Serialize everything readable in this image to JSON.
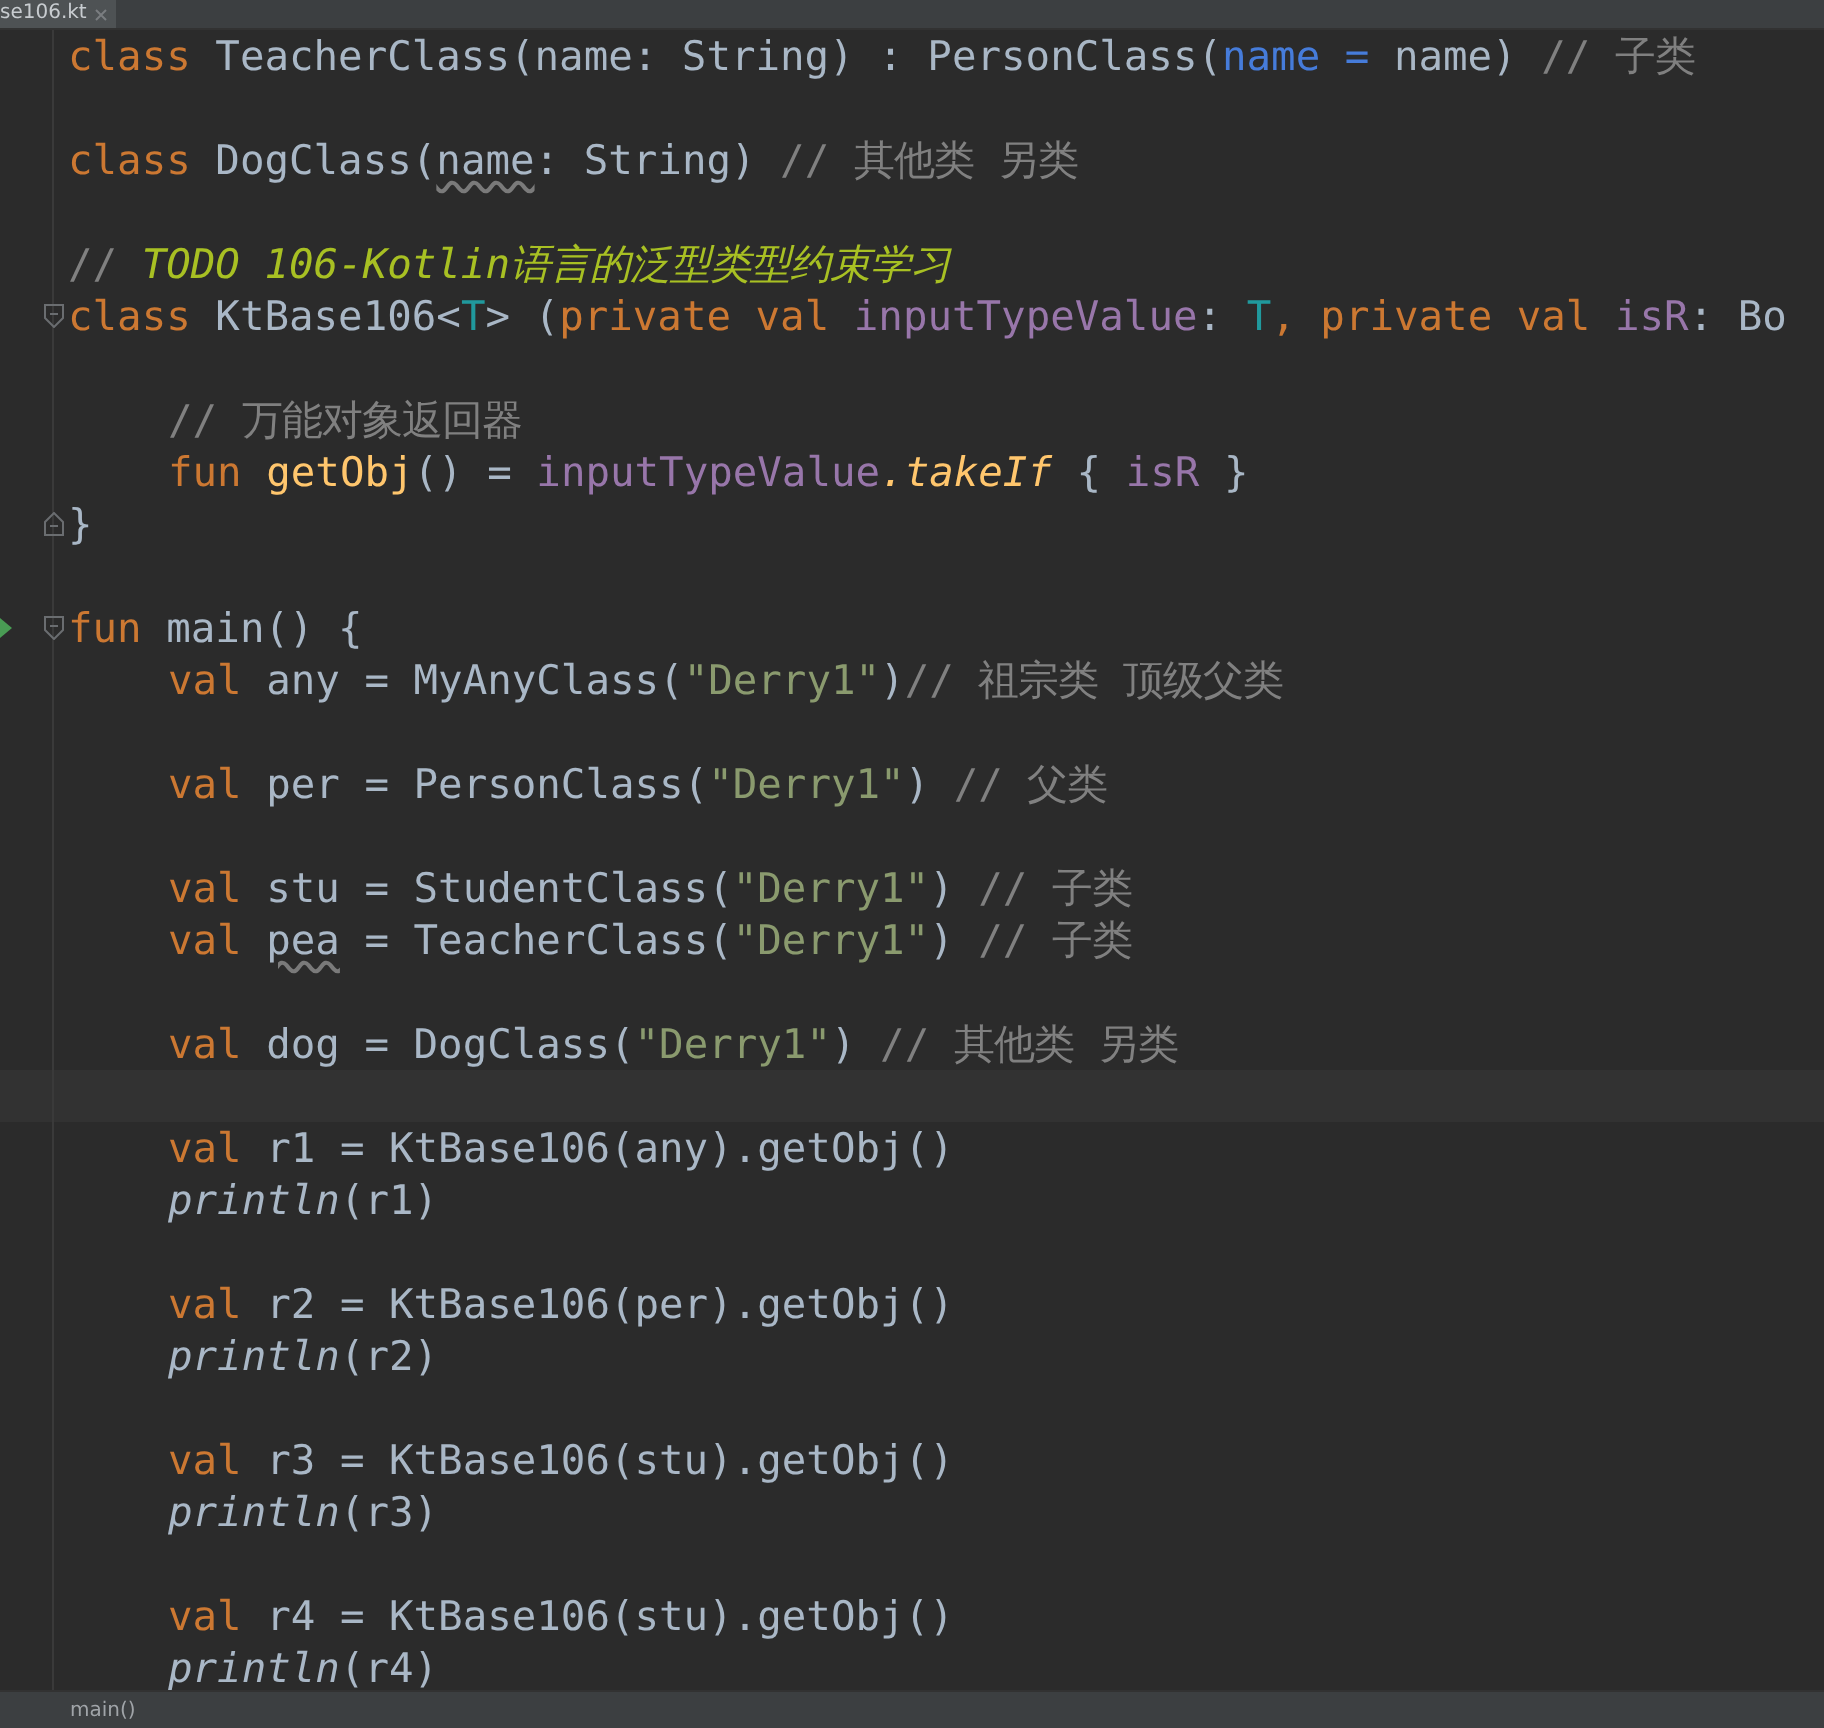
{
  "editor_tab": {
    "label": "se106.kt",
    "selected": true
  },
  "lines": [
    {
      "kind": "code",
      "indented": false,
      "fold_start": false,
      "fold_end": false,
      "runnable": false,
      "tokens": [
        {
          "text": "class ",
          "kind": "kw"
        },
        {
          "text": "TeacherClass(name: String) : PersonClass(",
          "kind": "plain"
        },
        {
          "text": "name = ",
          "kind": "param"
        },
        {
          "text": "name) ",
          "kind": "plain"
        },
        {
          "text": "// 子类",
          "kind": "comment"
        }
      ]
    },
    {
      "kind": "blank"
    },
    {
      "kind": "code",
      "indented": false,
      "fold_start": false,
      "fold_end": false,
      "runnable": false,
      "tokens": [
        {
          "text": "class ",
          "kind": "kw"
        },
        {
          "text": "DogClass(",
          "kind": "plain"
        },
        {
          "text": "name",
          "kind": "warn"
        },
        {
          "text": ": String) ",
          "kind": "plain"
        },
        {
          "text": "// 其他类 另类",
          "kind": "comment"
        }
      ]
    },
    {
      "kind": "blank"
    },
    {
      "kind": "code",
      "indented": false,
      "fold_start": false,
      "fold_end": false,
      "runnable": false,
      "tokens": [
        {
          "text": "// ",
          "kind": "comment"
        },
        {
          "text": "TODO 106-Kotlin语言的泛型类型约束学习",
          "kind": "todo"
        }
      ]
    },
    {
      "kind": "code",
      "indented": false,
      "fold_start": true,
      "fold_end": false,
      "runnable": false,
      "tokens": [
        {
          "text": "class ",
          "kind": "kw"
        },
        {
          "text": "KtBase106<",
          "kind": "plain"
        },
        {
          "text": "T",
          "kind": "tparam"
        },
        {
          "text": "> (",
          "kind": "plain"
        },
        {
          "text": "private val ",
          "kind": "kw"
        },
        {
          "text": "inputTypeValue",
          "kind": "prop"
        },
        {
          "text": ": ",
          "kind": "plain"
        },
        {
          "text": "T",
          "kind": "tparam"
        },
        {
          "text": ", ",
          "kind": "kw"
        },
        {
          "text": "private val ",
          "kind": "kw"
        },
        {
          "text": "isR",
          "kind": "prop"
        },
        {
          "text": ": Bo",
          "kind": "plain"
        }
      ]
    },
    {
      "kind": "blank"
    },
    {
      "kind": "code",
      "indented": true,
      "fold_start": false,
      "fold_end": false,
      "runnable": false,
      "tokens": [
        {
          "text": "// 万能对象返回器",
          "kind": "comment"
        }
      ]
    },
    {
      "kind": "code",
      "indented": true,
      "fold_start": false,
      "fold_end": false,
      "runnable": false,
      "tokens": [
        {
          "text": "fun ",
          "kind": "kw"
        },
        {
          "text": "getObj",
          "kind": "decl"
        },
        {
          "text": "() = ",
          "kind": "plain"
        },
        {
          "text": "inputTypeValue",
          "kind": "prop"
        },
        {
          "text": ".takeIf",
          "kind": "ext"
        },
        {
          "text": " { ",
          "kind": "plain"
        },
        {
          "text": "isR",
          "kind": "prop"
        },
        {
          "text": " }",
          "kind": "plain"
        }
      ]
    },
    {
      "kind": "code",
      "indented": false,
      "fold_start": false,
      "fold_end": true,
      "runnable": false,
      "tokens": [
        {
          "text": "}",
          "kind": "plain"
        }
      ]
    },
    {
      "kind": "blank"
    },
    {
      "kind": "code",
      "indented": false,
      "fold_start": true,
      "fold_end": false,
      "runnable": true,
      "tokens": [
        {
          "text": "fun ",
          "kind": "kw"
        },
        {
          "text": "main() {",
          "kind": "plain"
        }
      ]
    },
    {
      "kind": "code",
      "indented": true,
      "fold_start": false,
      "fold_end": false,
      "runnable": false,
      "tokens": [
        {
          "text": "val ",
          "kind": "kw"
        },
        {
          "text": "any = MyAnyClass(",
          "kind": "plain"
        },
        {
          "text": "\"Derry1\"",
          "kind": "str"
        },
        {
          "text": ")",
          "kind": "plain"
        },
        {
          "text": "// 祖宗类 顶级父类",
          "kind": "comment"
        }
      ]
    },
    {
      "kind": "blank"
    },
    {
      "kind": "code",
      "indented": true,
      "fold_start": false,
      "fold_end": false,
      "runnable": false,
      "tokens": [
        {
          "text": "val ",
          "kind": "kw"
        },
        {
          "text": "per = PersonClass(",
          "kind": "plain"
        },
        {
          "text": "\"Derry1\"",
          "kind": "str"
        },
        {
          "text": ") ",
          "kind": "plain"
        },
        {
          "text": "// 父类",
          "kind": "comment"
        }
      ]
    },
    {
      "kind": "blank"
    },
    {
      "kind": "code",
      "indented": true,
      "fold_start": false,
      "fold_end": false,
      "runnable": false,
      "tokens": [
        {
          "text": "val ",
          "kind": "kw"
        },
        {
          "text": "stu = StudentClass(",
          "kind": "plain"
        },
        {
          "text": "\"Derry1\"",
          "kind": "str"
        },
        {
          "text": ") ",
          "kind": "plain"
        },
        {
          "text": "// 子类",
          "kind": "comment"
        }
      ]
    },
    {
      "kind": "code",
      "indented": true,
      "fold_start": false,
      "fold_end": false,
      "runnable": false,
      "tokens": [
        {
          "text": "val ",
          "kind": "kw"
        },
        {
          "text": "pea",
          "kind": "warn"
        },
        {
          "text": " = TeacherClass(",
          "kind": "plain"
        },
        {
          "text": "\"Derry1\"",
          "kind": "str"
        },
        {
          "text": ") ",
          "kind": "plain"
        },
        {
          "text": "// 子类",
          "kind": "comment"
        }
      ]
    },
    {
      "kind": "blank"
    },
    {
      "kind": "code",
      "indented": true,
      "fold_start": false,
      "fold_end": false,
      "runnable": false,
      "tokens": [
        {
          "text": "val ",
          "kind": "kw"
        },
        {
          "text": "dog = DogClass(",
          "kind": "plain"
        },
        {
          "text": "\"Derry1\"",
          "kind": "str"
        },
        {
          "text": ") ",
          "kind": "plain"
        },
        {
          "text": "// 其他类 另类",
          "kind": "comment"
        }
      ]
    },
    {
      "kind": "caret_line"
    },
    {
      "kind": "code",
      "indented": true,
      "fold_start": false,
      "fold_end": false,
      "runnable": false,
      "tokens": [
        {
          "text": "val ",
          "kind": "kw"
        },
        {
          "text": "r1 = KtBase106(any).getObj()",
          "kind": "plain"
        }
      ]
    },
    {
      "kind": "code",
      "indented": true,
      "fold_start": false,
      "fold_end": false,
      "runnable": false,
      "tokens": [
        {
          "text": "println",
          "kind": "call"
        },
        {
          "text": "(r1)",
          "kind": "plain"
        }
      ]
    },
    {
      "kind": "blank"
    },
    {
      "kind": "code",
      "indented": true,
      "fold_start": false,
      "fold_end": false,
      "runnable": false,
      "tokens": [
        {
          "text": "val ",
          "kind": "kw"
        },
        {
          "text": "r2 = KtBase106(per).getObj()",
          "kind": "plain"
        }
      ]
    },
    {
      "kind": "code",
      "indented": true,
      "fold_start": false,
      "fold_end": false,
      "runnable": false,
      "tokens": [
        {
          "text": "println",
          "kind": "call"
        },
        {
          "text": "(r2)",
          "kind": "plain"
        }
      ]
    },
    {
      "kind": "blank"
    },
    {
      "kind": "code",
      "indented": true,
      "fold_start": false,
      "fold_end": false,
      "runnable": false,
      "tokens": [
        {
          "text": "val ",
          "kind": "kw"
        },
        {
          "text": "r3 = KtBase106(stu).getObj()",
          "kind": "plain"
        }
      ]
    },
    {
      "kind": "code",
      "indented": true,
      "fold_start": false,
      "fold_end": false,
      "runnable": false,
      "tokens": [
        {
          "text": "println",
          "kind": "call"
        },
        {
          "text": "(r3)",
          "kind": "plain"
        }
      ]
    },
    {
      "kind": "blank"
    },
    {
      "kind": "code",
      "indented": true,
      "fold_start": false,
      "fold_end": false,
      "runnable": false,
      "tokens": [
        {
          "text": "val ",
          "kind": "kw"
        },
        {
          "text": "r4 = KtBase106(stu).getObj()",
          "kind": "plain"
        }
      ]
    },
    {
      "kind": "code",
      "indented": true,
      "fold_start": false,
      "fold_end": false,
      "runnable": false,
      "tokens": [
        {
          "text": "println",
          "kind": "call"
        },
        {
          "text": "(r4)",
          "kind": "plain"
        }
      ]
    }
  ],
  "breadcrumb": "main()"
}
